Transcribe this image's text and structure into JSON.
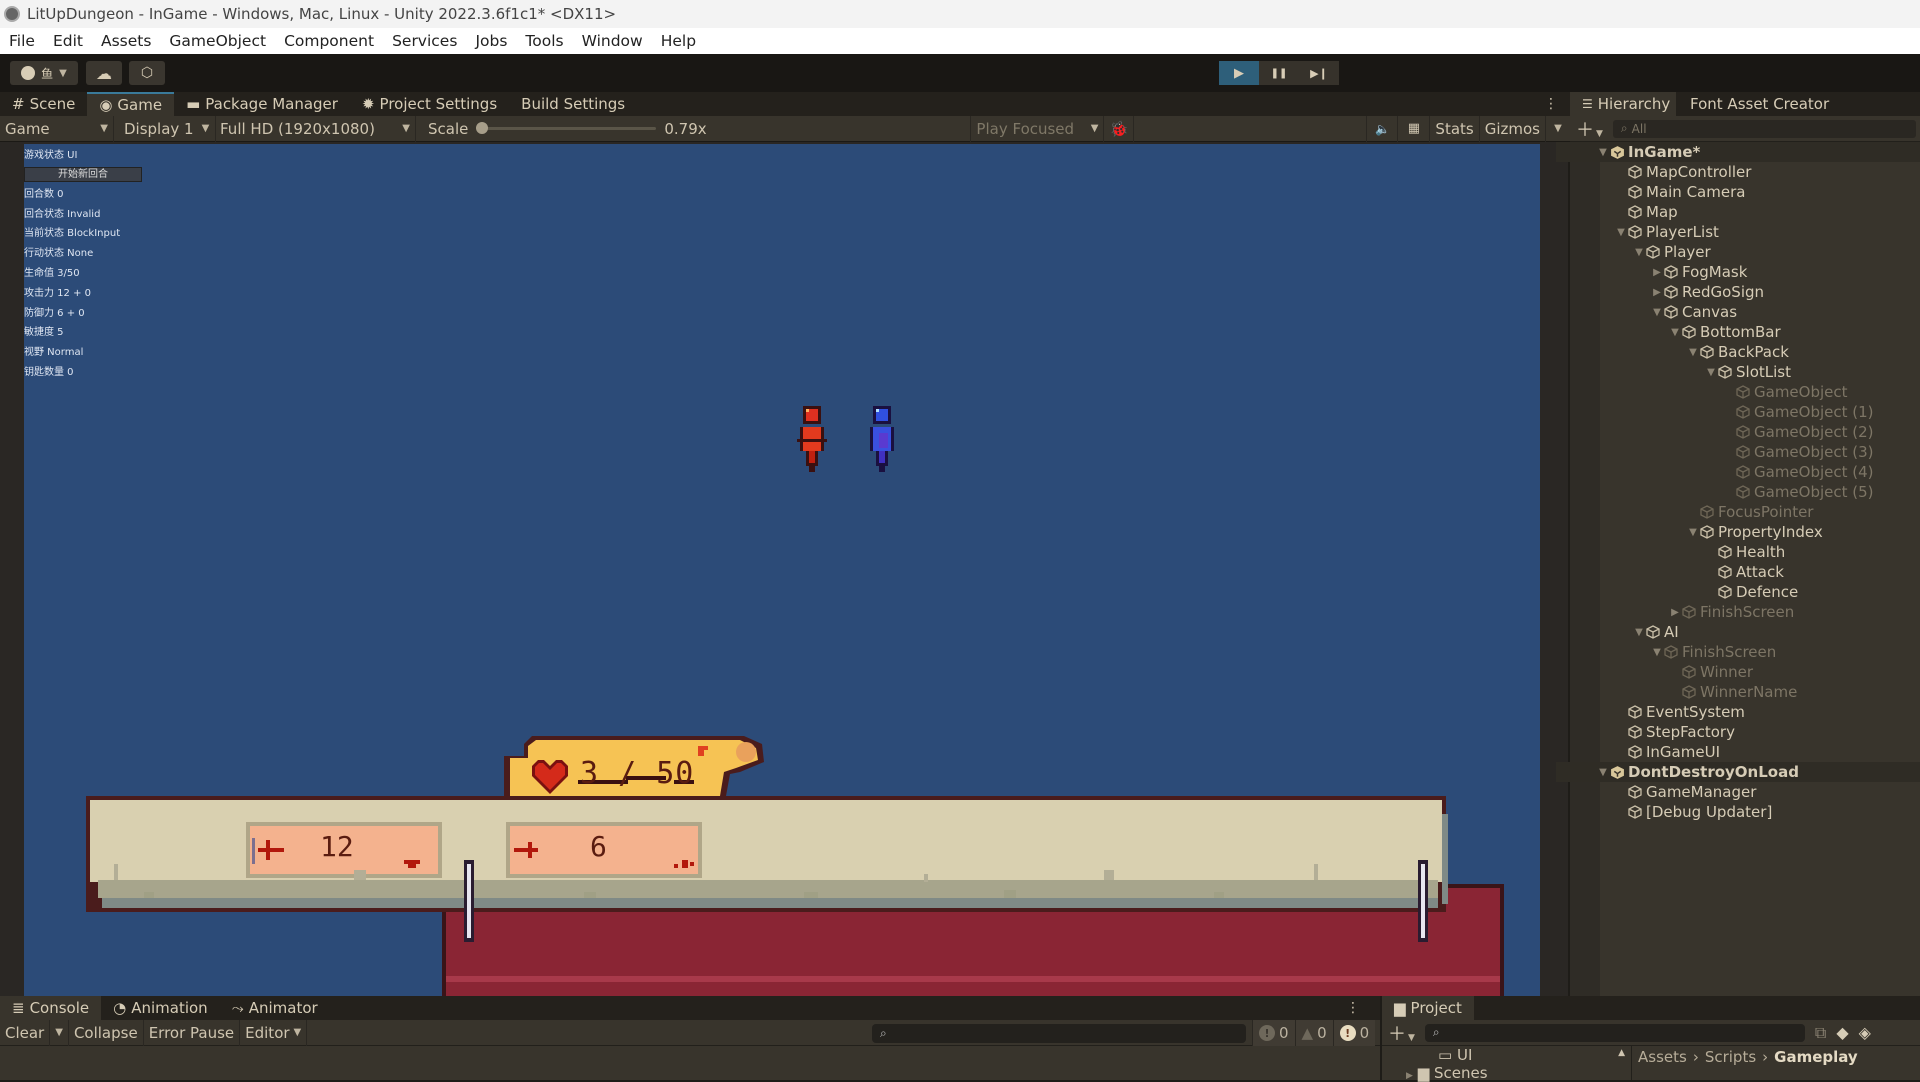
{
  "window": {
    "title": "LitUpDungeon - InGame - Windows, Mac, Linux - Unity 2022.3.6f1c1* <DX11>"
  },
  "menu": [
    "File",
    "Edit",
    "Assets",
    "GameObject",
    "Component",
    "Services",
    "Jobs",
    "Tools",
    "Window",
    "Help"
  ],
  "toolbar": {
    "account_icon": "account-icon",
    "layers_glyph": "鱼",
    "cloud_icon": "cloud-icon",
    "plastic_icon": "plastic-scm-icon",
    "play": "▶",
    "pause": "❚❚",
    "step": "▶❙",
    "play_active_color": "#2e5f7a"
  },
  "center_tabs": [
    {
      "label": "Scene",
      "icon": "#"
    },
    {
      "label": "Game",
      "icon": "◉",
      "active": true
    },
    {
      "label": "Package Manager",
      "icon": "▬"
    },
    {
      "label": "Project Settings",
      "icon": "✹"
    },
    {
      "label": "Build Settings",
      "icon": ""
    }
  ],
  "gamebar": {
    "view": "Game",
    "display": "Display 1",
    "resolution": "Full HD (1920x1080)",
    "scale_label": "Scale",
    "scale_value": "0.79x",
    "play_mode": "Play Focused",
    "stats": "Stats",
    "gizmos": "Gizmos"
  },
  "debug_panel": {
    "game_state": "游戏状态 UI",
    "new_round_button": "开始新回合",
    "lines": [
      "回合数 0",
      "回合状态 Invalid",
      "当前状态 BlockInput",
      "行动状态 None",
      "生命值 3/50",
      "攻击力 12 + 0",
      "防御力 6 + 0",
      "敏捷度 5",
      "视野 Normal",
      "钥匙数量 0"
    ]
  },
  "game_hud": {
    "health_current": "3",
    "health_sep": "/",
    "health_max": "50",
    "attack_value": "12",
    "defence_value": "6",
    "colors": {
      "viewport_bg": "#2c4b78",
      "health_scroll": "#f6c354",
      "stat_box": "#f4b28e",
      "bar_bg": "#d9d0b0",
      "bar_base": "#8a2534"
    }
  },
  "hierarchy": {
    "tabs": [
      "Hierarchy",
      "Font Asset Creator"
    ],
    "search_placeholder": "All",
    "items": [
      {
        "name": "InGame*",
        "depth": 0,
        "type": "scene",
        "expanded": true
      },
      {
        "name": "MapController",
        "depth": 1
      },
      {
        "name": "Main Camera",
        "depth": 1
      },
      {
        "name": "Map",
        "depth": 1
      },
      {
        "name": "PlayerList",
        "depth": 1,
        "expanded": true
      },
      {
        "name": "Player",
        "depth": 2,
        "expanded": true
      },
      {
        "name": "FogMask",
        "depth": 3,
        "collapsed": true
      },
      {
        "name": "RedGoSign",
        "depth": 3,
        "collapsed": true
      },
      {
        "name": "Canvas",
        "depth": 3,
        "expanded": true
      },
      {
        "name": "BottomBar",
        "depth": 4,
        "expanded": true
      },
      {
        "name": "BackPack",
        "depth": 5,
        "expanded": true
      },
      {
        "name": "SlotList",
        "depth": 6,
        "expanded": true
      },
      {
        "name": "GameObject",
        "depth": 7,
        "dim": true
      },
      {
        "name": "GameObject (1)",
        "depth": 7,
        "dim": true
      },
      {
        "name": "GameObject (2)",
        "depth": 7,
        "dim": true
      },
      {
        "name": "GameObject (3)",
        "depth": 7,
        "dim": true
      },
      {
        "name": "GameObject (4)",
        "depth": 7,
        "dim": true
      },
      {
        "name": "GameObject (5)",
        "depth": 7,
        "dim": true
      },
      {
        "name": "FocusPointer",
        "depth": 5,
        "dim": true
      },
      {
        "name": "PropertyIndex",
        "depth": 5,
        "expanded": true
      },
      {
        "name": "Health",
        "depth": 6
      },
      {
        "name": "Attack",
        "depth": 6
      },
      {
        "name": "Defence",
        "depth": 6
      },
      {
        "name": "FinishScreen",
        "depth": 4,
        "collapsed": true,
        "dim": true
      },
      {
        "name": "AI",
        "depth": 2,
        "expanded": true
      },
      {
        "name": "FinishScreen",
        "depth": 3,
        "expanded": true,
        "dim": true
      },
      {
        "name": "Winner",
        "depth": 4,
        "dim": true
      },
      {
        "name": "WinnerName",
        "depth": 4,
        "dim": true
      },
      {
        "name": "EventSystem",
        "depth": 1
      },
      {
        "name": "StepFactory",
        "depth": 1
      },
      {
        "name": "InGameUI",
        "depth": 1
      },
      {
        "name": "DontDestroyOnLoad",
        "depth": 0,
        "type": "scene",
        "expanded": true
      },
      {
        "name": "GameManager",
        "depth": 1
      },
      {
        "name": "[Debug Updater]",
        "depth": 1
      }
    ]
  },
  "console": {
    "tabs": [
      {
        "label": "Console",
        "icon": "≣",
        "active": true
      },
      {
        "label": "Animation",
        "icon": "◔"
      },
      {
        "label": "Animator",
        "icon": "⤳"
      }
    ],
    "buttons": {
      "clear": "Clear",
      "collapse": "Collapse",
      "error_pause": "Error Pause",
      "editor": "Editor"
    },
    "log_count": "0",
    "warning_count": "0",
    "error_count": "0"
  },
  "project": {
    "tab": "Project",
    "tree": [
      "UI",
      "Scenes"
    ],
    "breadcrumb": [
      "Assets",
      "Scripts",
      "Gameplay"
    ]
  }
}
